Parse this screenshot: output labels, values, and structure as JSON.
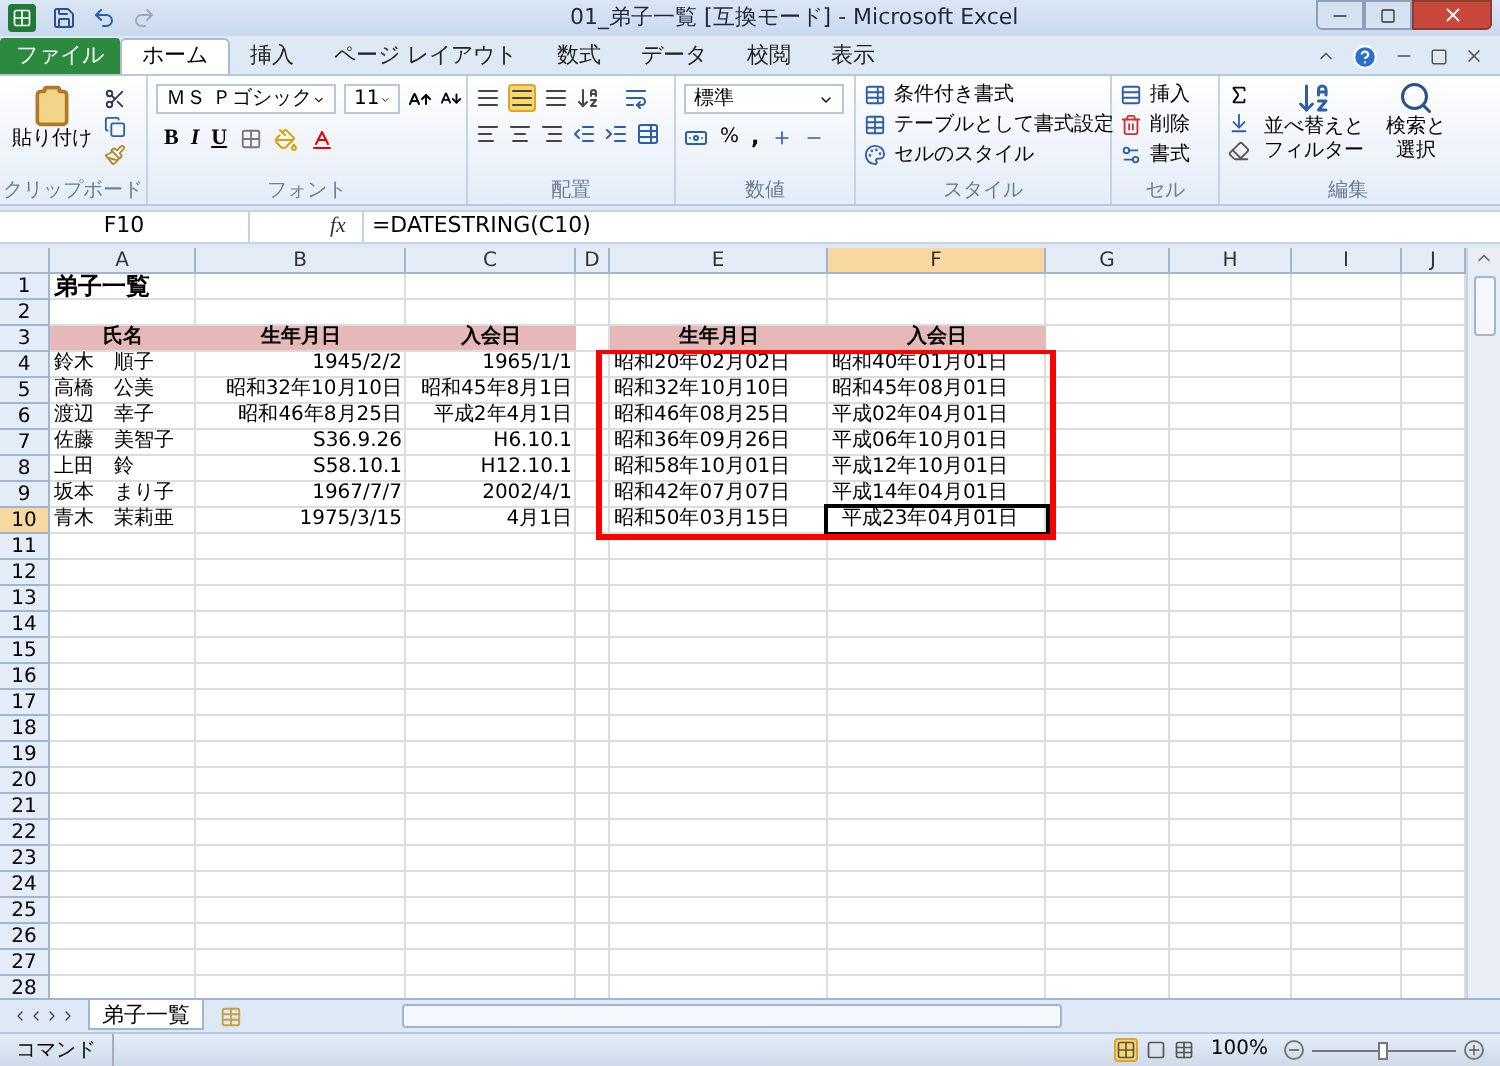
{
  "window": {
    "title": "01_弟子一覧 [互換モード] - Microsoft Excel"
  },
  "ribbon_tabs": [
    {
      "label": "ファイル",
      "kind": "file",
      "selected": false
    },
    {
      "label": "ホーム",
      "kind": "tab",
      "selected": true
    },
    {
      "label": "挿入",
      "kind": "tab",
      "selected": false
    },
    {
      "label": "ページ レイアウト",
      "kind": "tab",
      "selected": false
    },
    {
      "label": "数式",
      "kind": "tab",
      "selected": false
    },
    {
      "label": "データ",
      "kind": "tab",
      "selected": false
    },
    {
      "label": "校閲",
      "kind": "tab",
      "selected": false
    },
    {
      "label": "表示",
      "kind": "tab",
      "selected": false
    }
  ],
  "clipboard": {
    "label": "クリップボード",
    "paste": "貼り付け"
  },
  "font": {
    "label": "フォント",
    "name": "ＭＳ Ｐゴシック",
    "size": "11",
    "format_buttons": [
      "B",
      "I",
      "U"
    ]
  },
  "alignment": {
    "label": "配置"
  },
  "number": {
    "label": "数値",
    "format": "標準",
    "percent": "%",
    "comma": ","
  },
  "styles": {
    "label": "スタイル",
    "items": [
      "条件付き書式",
      "テーブルとして書式設定",
      "セルのスタイル"
    ]
  },
  "cells": {
    "label": "セル",
    "items": [
      "挿入",
      "削除",
      "書式"
    ]
  },
  "editing": {
    "label": "編集",
    "items": [
      "並べ替えとフィルター",
      "検索と選択"
    ]
  },
  "formula_bar": {
    "name_box": "F10",
    "fx": "fx",
    "formula": "=DATESTRING(C10)"
  },
  "sheet": {
    "columns": [
      {
        "label": "A",
        "selected": false
      },
      {
        "label": "B",
        "selected": false
      },
      {
        "label": "C",
        "selected": false
      },
      {
        "label": "D",
        "selected": false
      },
      {
        "label": "E",
        "selected": false
      },
      {
        "label": "F",
        "selected": true
      },
      {
        "label": "G",
        "selected": false
      },
      {
        "label": "H",
        "selected": false
      },
      {
        "label": "I",
        "selected": false
      },
      {
        "label": "J",
        "selected": false
      }
    ],
    "rows": [
      {
        "label": "1",
        "selected": false,
        "cells": [
          {
            "kind": "title",
            "text": "弟子一覧"
          }
        ]
      },
      {
        "label": "2",
        "selected": false
      },
      {
        "label": "3",
        "selected": false,
        "cells": [
          {
            "kind": "header",
            "text": "氏名"
          },
          {
            "kind": "header",
            "text": "生年月日"
          },
          {
            "kind": "header",
            "text": "入会日"
          },
          {
            "kind": "blank"
          },
          {
            "kind": "header",
            "text": "生年月日"
          },
          {
            "kind": "header",
            "text": "入会日"
          }
        ]
      },
      {
        "label": "4",
        "selected": false,
        "cells": [
          {
            "kind": "text",
            "text": "鈴木　順子"
          },
          {
            "kind": "number",
            "text": "1945/2/2"
          },
          {
            "kind": "number",
            "text": "1965/1/1"
          },
          {
            "kind": "blank"
          },
          {
            "kind": "text",
            "text": "昭和20年02月02日"
          },
          {
            "kind": "text",
            "text": "昭和40年01月01日"
          }
        ]
      },
      {
        "label": "5",
        "selected": false,
        "cells": [
          {
            "kind": "text",
            "text": "高橋　公美"
          },
          {
            "kind": "number",
            "text": "昭和32年10月10日"
          },
          {
            "kind": "number",
            "text": "昭和45年8月1日"
          },
          {
            "kind": "blank"
          },
          {
            "kind": "text",
            "text": "昭和32年10月10日"
          },
          {
            "kind": "text",
            "text": "昭和45年08月01日"
          }
        ]
      },
      {
        "label": "6",
        "selected": false,
        "cells": [
          {
            "kind": "text",
            "text": "渡辺　幸子"
          },
          {
            "kind": "number",
            "text": "昭和46年8月25日"
          },
          {
            "kind": "number",
            "text": "平成2年4月1日"
          },
          {
            "kind": "blank"
          },
          {
            "kind": "text",
            "text": "昭和46年08月25日"
          },
          {
            "kind": "text",
            "text": "平成02年04月01日"
          }
        ]
      },
      {
        "label": "7",
        "selected": false,
        "cells": [
          {
            "kind": "text",
            "text": "佐藤　美智子"
          },
          {
            "kind": "number",
            "text": "S36.9.26"
          },
          {
            "kind": "number",
            "text": "H6.10.1"
          },
          {
            "kind": "blank"
          },
          {
            "kind": "text",
            "text": "昭和36年09月26日"
          },
          {
            "kind": "text",
            "text": "平成06年10月01日"
          }
        ]
      },
      {
        "label": "8",
        "selected": false,
        "cells": [
          {
            "kind": "text",
            "text": "上田　鈴"
          },
          {
            "kind": "number",
            "text": "S58.10.1"
          },
          {
            "kind": "number",
            "text": "H12.10.1"
          },
          {
            "kind": "blank"
          },
          {
            "kind": "text",
            "text": "昭和58年10月01日"
          },
          {
            "kind": "text",
            "text": "平成12年10月01日"
          }
        ]
      },
      {
        "label": "9",
        "selected": false,
        "cells": [
          {
            "kind": "text",
            "text": "坂本　まり子"
          },
          {
            "kind": "number",
            "text": "1967/7/7"
          },
          {
            "kind": "number",
            "text": "2002/4/1"
          },
          {
            "kind": "blank"
          },
          {
            "kind": "text",
            "text": "昭和42年07月07日"
          },
          {
            "kind": "text",
            "text": "平成14年04月01日"
          }
        ]
      },
      {
        "label": "10",
        "selected": true,
        "cells": [
          {
            "kind": "text",
            "text": "青木　茉莉亜"
          },
          {
            "kind": "number",
            "text": "1975/3/15"
          },
          {
            "kind": "number",
            "text": "4月1日"
          },
          {
            "kind": "blank"
          },
          {
            "kind": "text",
            "text": "昭和50年03月15日"
          },
          {
            "kind": "text",
            "text": "平成23年04月01日"
          }
        ]
      },
      {
        "label": "11",
        "selected": false
      },
      {
        "label": "12",
        "selected": false
      },
      {
        "label": "13",
        "selected": false
      },
      {
        "label": "14",
        "selected": false
      },
      {
        "label": "15",
        "selected": false
      },
      {
        "label": "16",
        "selected": false
      },
      {
        "label": "17",
        "selected": false
      },
      {
        "label": "18",
        "selected": false
      },
      {
        "label": "19",
        "selected": false
      },
      {
        "label": "20",
        "selected": false
      },
      {
        "label": "21",
        "selected": false
      },
      {
        "label": "22",
        "selected": false
      },
      {
        "label": "23",
        "selected": false
      },
      {
        "label": "24",
        "selected": false
      },
      {
        "label": "25",
        "selected": false
      },
      {
        "label": "26",
        "selected": false
      },
      {
        "label": "27",
        "selected": false
      },
      {
        "label": "28",
        "selected": false
      }
    ]
  },
  "sheet_tabs": [
    {
      "label": "弟子一覧",
      "selected": true
    }
  ],
  "status_bar": {
    "mode": "コマンド",
    "zoom": "100%",
    "zoom_slider": {
      "level": 0.5
    }
  }
}
